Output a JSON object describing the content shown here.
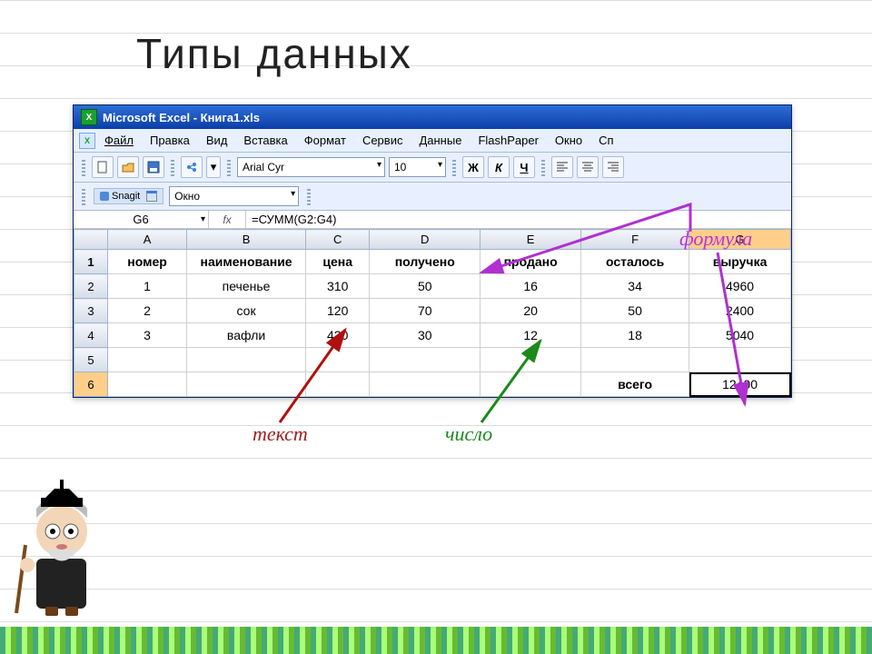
{
  "slide_title": "Типы  данных",
  "titlebar": "Microsoft Excel - Книга1.xls",
  "menu": [
    "Файл",
    "Правка",
    "Вид",
    "Вставка",
    "Формат",
    "Сервис",
    "Данные",
    "FlashPaper",
    "Окно",
    "Сп"
  ],
  "font_name": "Arial Cyr",
  "font_size": "10",
  "snagit_label": "Snagit",
  "snagit_window": "Окно",
  "namebox": "G6",
  "fx_label": "fx",
  "formula": "=СУММ(G2:G4)",
  "columns": [
    "A",
    "B",
    "C",
    "D",
    "E",
    "F",
    "G"
  ],
  "selected_col": "G",
  "selected_row": "6",
  "row_labels": [
    "1",
    "2",
    "3",
    "4",
    "5",
    "6"
  ],
  "rows": [
    {
      "a": "номер",
      "b": "наименование",
      "c": "цена",
      "d": "получено",
      "e": "продано",
      "f": "осталось",
      "g": "выручка"
    },
    {
      "a": "1",
      "b": "печенье",
      "c": "310",
      "d": "50",
      "e": "16",
      "f": "34",
      "g": "4960"
    },
    {
      "a": "2",
      "b": "сок",
      "c": "120",
      "d": "70",
      "e": "20",
      "f": "50",
      "g": "2400"
    },
    {
      "a": "3",
      "b": "вафли",
      "c": "420",
      "d": "30",
      "e": "12",
      "f": "18",
      "g": "5040"
    },
    {
      "a": "",
      "b": "",
      "c": "",
      "d": "",
      "e": "",
      "f": "",
      "g": ""
    },
    {
      "a": "",
      "b": "",
      "c": "",
      "d": "",
      "e": "",
      "f": "всего",
      "g": "12400"
    }
  ],
  "annotations": {
    "text": "текст",
    "number": "число",
    "formula": "формула"
  },
  "bold_labels": {
    "b": "Ж",
    "i": "К",
    "u": "Ч"
  }
}
